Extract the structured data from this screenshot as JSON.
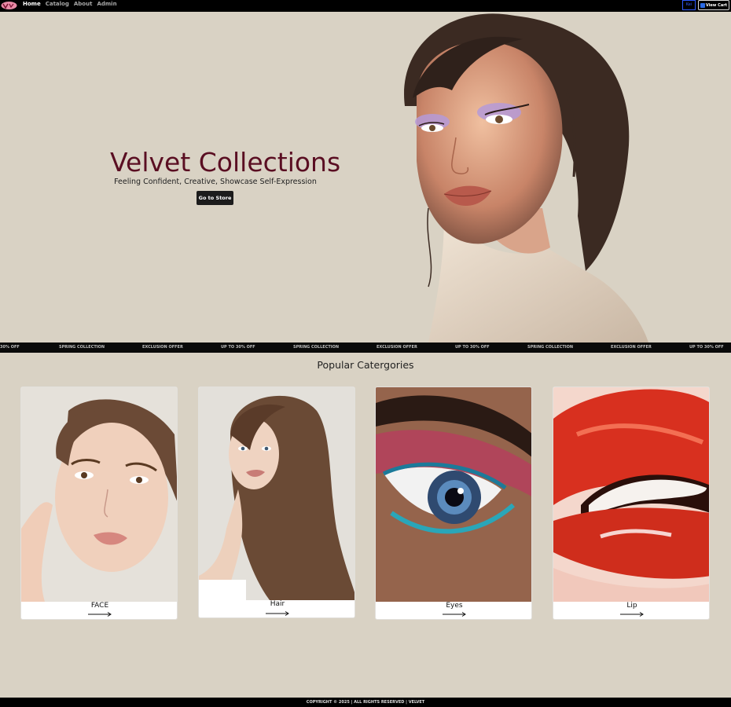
{
  "nav": {
    "links": [
      "Home",
      "Catalog",
      "About",
      "Admin"
    ],
    "user_label": "Kei",
    "cart_label": "View Cart"
  },
  "hero": {
    "title": "Velvet Collections",
    "subtitle": "Feeling Confident, Creative, Showcase Self-Expression",
    "button": "Go to Store"
  },
  "ticker": [
    "30% OFF",
    "SPRING COLLECTION",
    "EXCLUSION OFFER",
    "UP TO 30% OFF",
    "SPRING COLLECTION",
    "EXCLUSION OFFER",
    "UP TO 30% OFF",
    "SPRING COLLECTION",
    "EXCLUSION OFFER",
    "UP TO 30% OFF"
  ],
  "categories": {
    "title": "Popular Catergories",
    "items": [
      {
        "label": "FACE"
      },
      {
        "label": "Hair"
      },
      {
        "label": "Eyes"
      },
      {
        "label": "Lip"
      }
    ]
  },
  "footer": "COPYRIGHT © 2025 | ALL RIGHTS RESERVED | VELVET",
  "colors": {
    "accent": "#5a0e22",
    "background": "#d9d2c4",
    "nav": "#000000"
  }
}
